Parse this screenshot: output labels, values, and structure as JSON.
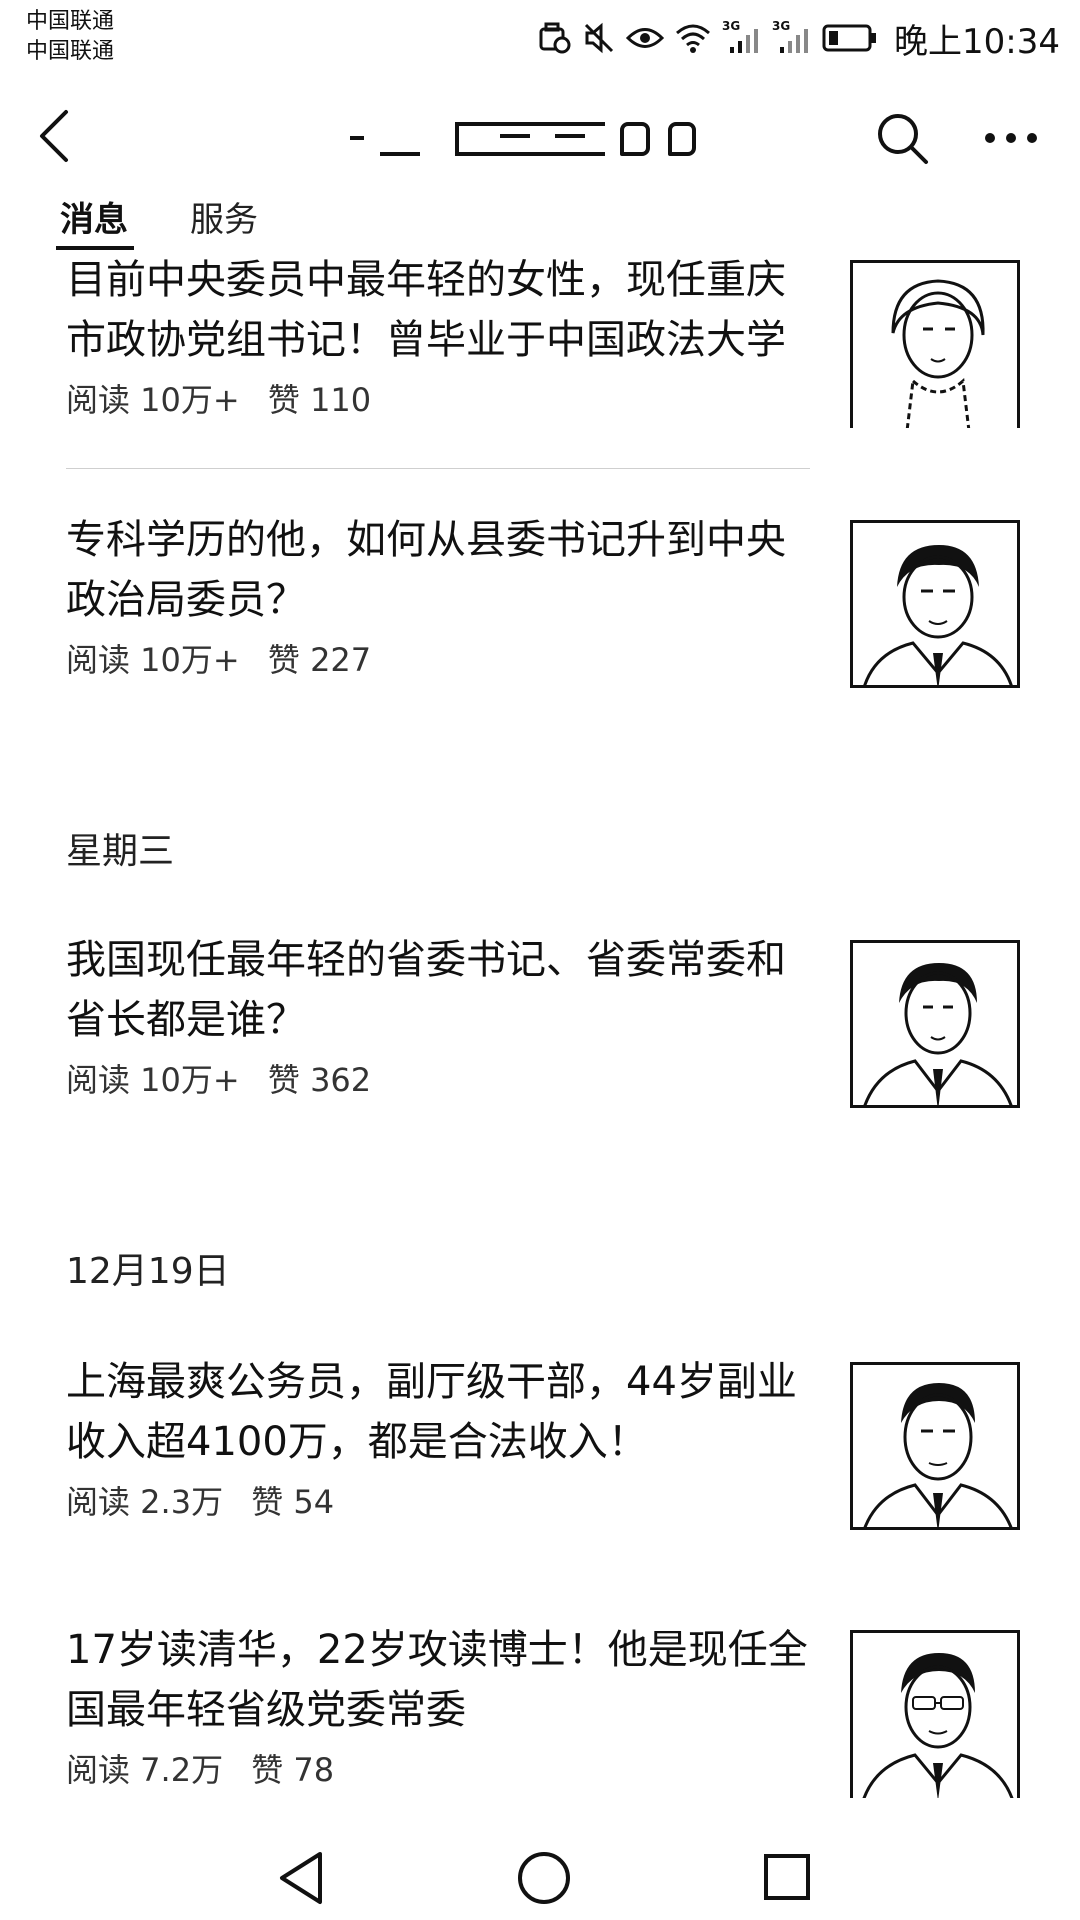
{
  "status_bar": {
    "carrier_1": "中国联通",
    "carrier_2": "中国联通",
    "network_1": "3G",
    "network_2": "3G",
    "time": "晚上10:34"
  },
  "tabs": {
    "messages": "消息",
    "services": "服务"
  },
  "groups": [
    {
      "date": ""
    },
    {
      "date": "星期三"
    },
    {
      "date": "12月19日"
    }
  ],
  "articles": [
    {
      "title": "目前中央委员中最年轻的女性，现任重庆市政协党组书记！曾毕业于中国政法大学",
      "reads": "阅读 10万+",
      "likes": "赞 110"
    },
    {
      "title": "专科学历的他，如何从县委书记升到中央政治局委员？",
      "reads": "阅读 10万+",
      "likes": "赞 227"
    },
    {
      "title": "我国现任最年轻的省委书记、省委常委和省长都是谁？",
      "reads": "阅读 10万+",
      "likes": "赞 362"
    },
    {
      "title": "上海最爽公务员，副厅级干部，44岁副业收入超4100万，都是合法收入！",
      "reads": "阅读 2.3万",
      "likes": "赞 54"
    },
    {
      "title": "17岁读清华，22岁攻读博士！他是现任全国最年轻省级党委常委",
      "reads": "阅读 7.2万",
      "likes": "赞 78"
    }
  ],
  "icons": {
    "back": "chevron-left-icon",
    "search": "search-icon",
    "more": "more-icon",
    "nav_back": "triangle-back-icon",
    "nav_home": "circle-home-icon",
    "nav_recents": "square-recents-icon"
  }
}
